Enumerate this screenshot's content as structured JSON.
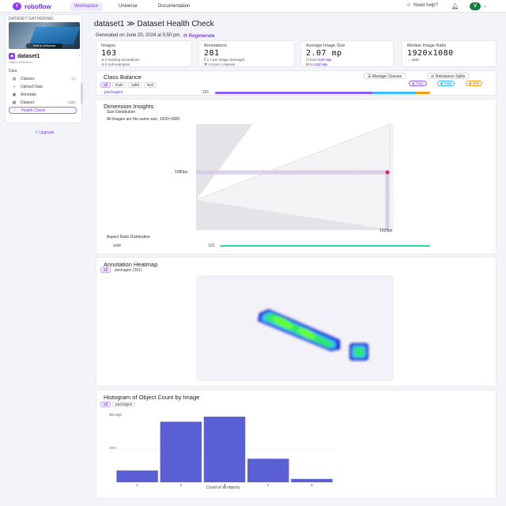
{
  "topbar": {
    "brand": "roboflow",
    "nav": [
      "Workspace",
      "Universe",
      "Documentation"
    ],
    "help": "Need help?",
    "avatar_letter": "V"
  },
  "sidebar": {
    "workspace_title": "DATASET GATHERING",
    "thumb_caption": "Visit in Universe",
    "project_name": "dataset1",
    "project_sub": "Object Detection",
    "section": "Data",
    "items": [
      {
        "label": "Classes",
        "icon": "classes-icon",
        "count": "1"
      },
      {
        "label": "Upload Data",
        "icon": "upload-icon",
        "count": ""
      },
      {
        "label": "Annotate",
        "icon": "annotate-icon",
        "count": ""
      },
      {
        "label": "Dataset",
        "icon": "dataset-icon",
        "count": "103"
      },
      {
        "label": "Health Check",
        "icon": "health-icon",
        "count": ""
      }
    ],
    "upgrade": "Upgrade"
  },
  "header": {
    "breadcrumb_project": "dataset1",
    "separator": "≫",
    "title": "Dataset Health Check",
    "generated": "Generated on June 20, 2024 at 5:50 pm.",
    "regenerate": "Regenerate"
  },
  "stats": [
    {
      "label": "Images",
      "value": "103",
      "sub1": "0 missing annotations",
      "sub2": "0 null examples"
    },
    {
      "label": "Annotations",
      "value": "281",
      "sub1": "2.7 per image (average)",
      "sub2": "Across 1 classes"
    },
    {
      "label": "Average Image Size",
      "value": "2.07 mp",
      "sub1_prefix": "from",
      "sub1_val": "2.07 mp",
      "sub2_prefix": "to",
      "sub2_val": "2.07 mp"
    },
    {
      "label": "Median Image Ratio",
      "value": "1920x1080",
      "sub1": "wide"
    }
  ],
  "class_balance": {
    "title": "Class Balance",
    "filters": [
      "all",
      "train",
      "valid",
      "test"
    ],
    "manage": "Manage Classes",
    "rebalance": "Rebalance Splits",
    "splits": [
      "Train",
      "Valid",
      "Test"
    ],
    "split_colors": {
      "train": "#8b5cf6",
      "valid": "#38bdf8",
      "test": "#f59e0b"
    },
    "rows": [
      {
        "class": "packages",
        "count": "281",
        "train": 0.73,
        "valid": 0.2,
        "test": 0.07
      }
    ]
  },
  "dimension": {
    "title": "Dimension Insights",
    "size_dist": "Size Distribution",
    "note": "All images are the same size, 1920×1080.",
    "y_marker": "1080px",
    "x_marker": "1920px",
    "aspect_title": "Aspect Ratio Distribution",
    "aspect_rows": [
      {
        "label": "wide",
        "count": "103",
        "fraction": 1.0
      }
    ]
  },
  "heatmap": {
    "title": "Annotation Heatmap",
    "filters": [
      "all",
      "packages (281)"
    ]
  },
  "histogram": {
    "title": "Histogram of Object Count by Image",
    "filters": [
      "all",
      "packages"
    ],
    "xlabel": "Count of all objects",
    "y_top_label": "39 imgs",
    "y_mid_label": "19.5",
    "chart_data": {
      "type": "bar",
      "categories": [
        "1",
        "2",
        "3",
        "4",
        "5"
      ],
      "values": [
        7,
        36,
        39,
        14,
        2
      ],
      "xlabel": "Count of all objects",
      "ylim": [
        0,
        39
      ]
    }
  },
  "colors": {
    "accent": "#7a3df0",
    "bar": "#5b5fd6",
    "aspect_bar": "#2dd4a8"
  }
}
